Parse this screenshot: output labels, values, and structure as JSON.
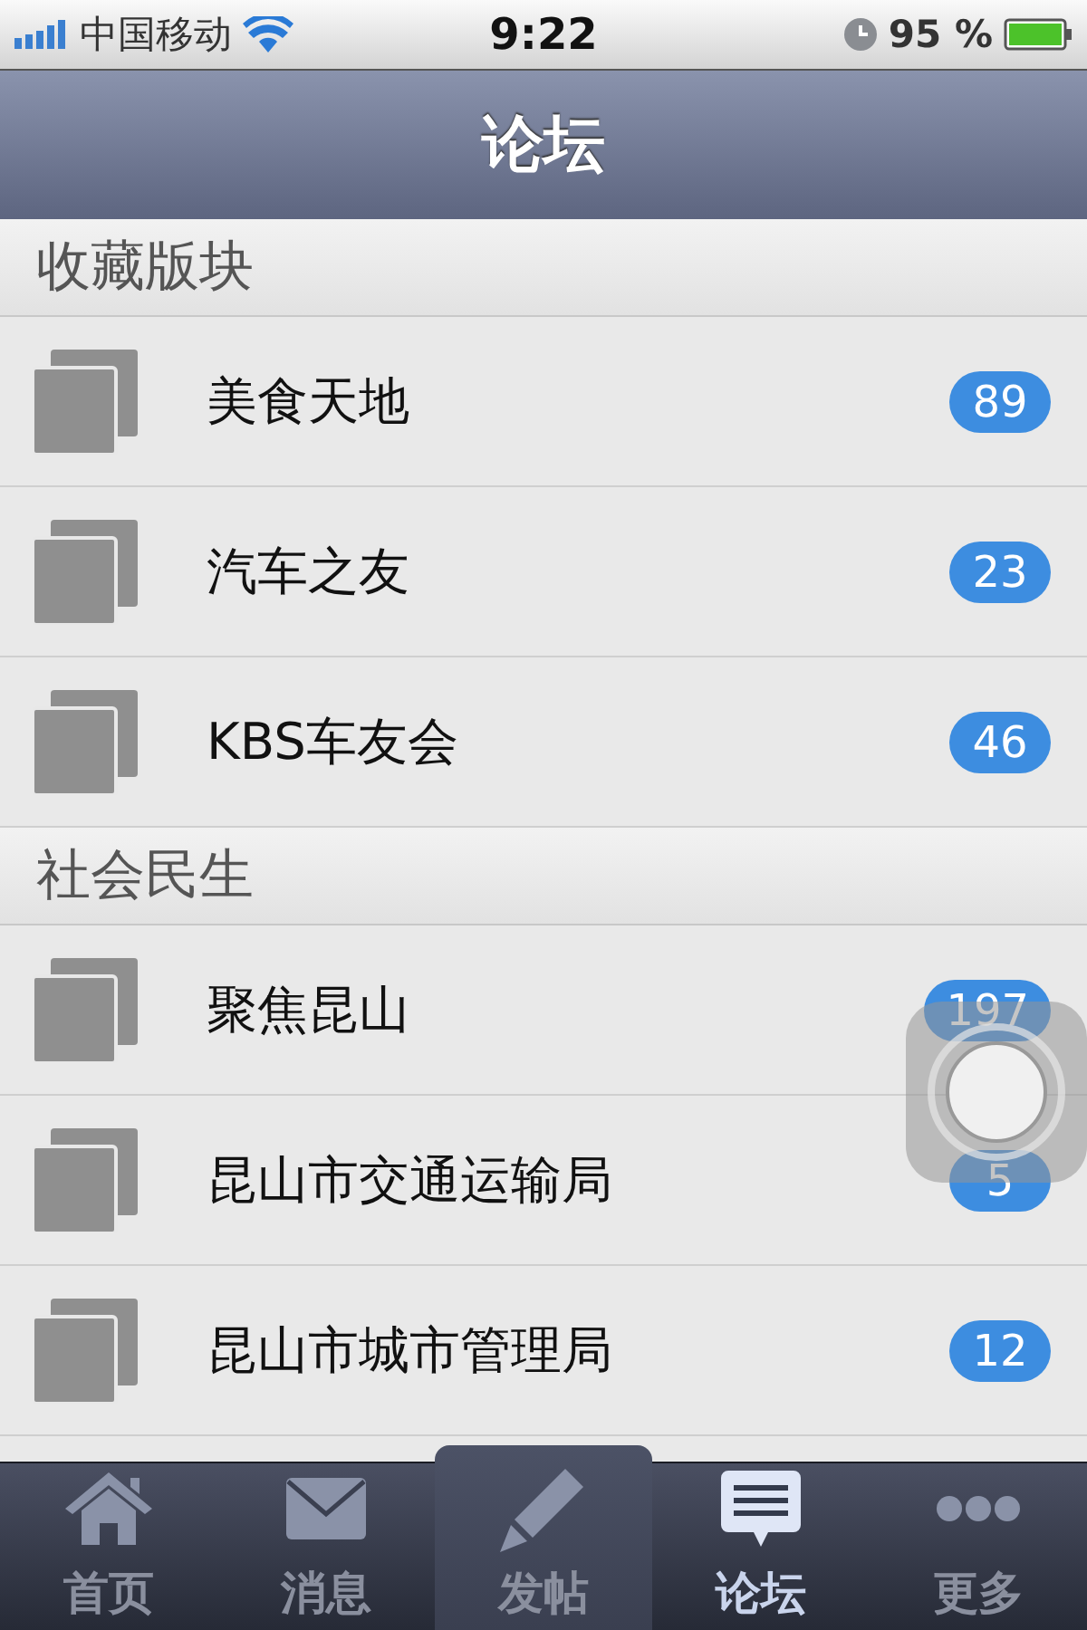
{
  "status_bar": {
    "carrier": "中国移动",
    "time": "9:22",
    "battery": "95 %"
  },
  "nav_bar": {
    "title": "论坛"
  },
  "sections": [
    {
      "title": "收藏版块",
      "items": [
        {
          "name": "美食天地",
          "count": "89"
        },
        {
          "name": "汽车之友",
          "count": "23"
        },
        {
          "name": "KBS车友会",
          "count": "46"
        }
      ]
    },
    {
      "title": "社会民生",
      "items": [
        {
          "name": "聚焦昆山",
          "count": "197"
        },
        {
          "name": "昆山市交通运输局",
          "count": "5"
        },
        {
          "name": "昆山市城市管理局",
          "count": "12"
        }
      ]
    }
  ],
  "tab_bar": [
    {
      "label": "首页",
      "kind": "home",
      "selected": false
    },
    {
      "label": "消息",
      "kind": "mail",
      "selected": false
    },
    {
      "label": "发帖",
      "kind": "compose",
      "selected": false
    },
    {
      "label": "论坛",
      "kind": "forum",
      "selected": true
    },
    {
      "label": "更多",
      "kind": "more",
      "selected": false
    }
  ]
}
